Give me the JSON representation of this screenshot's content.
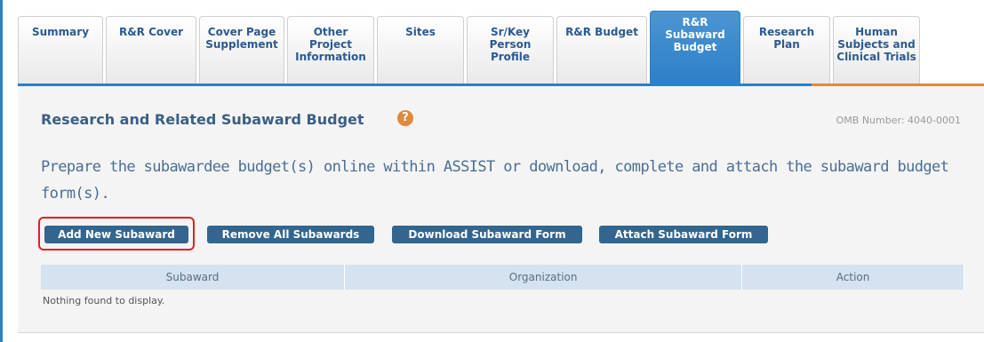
{
  "tabs": [
    {
      "label": "Summary",
      "active": false
    },
    {
      "label": "R&R Cover",
      "active": false
    },
    {
      "label": "Cover Page\nSupplement",
      "active": false
    },
    {
      "label": "Other\nProject\nInformation",
      "active": false
    },
    {
      "label": "Sites",
      "active": false
    },
    {
      "label": "Sr/Key\nPerson\nProfile",
      "active": false
    },
    {
      "label": "R&R Budget",
      "active": false
    },
    {
      "label": "R&R\nSubaward\nBudget",
      "active": true
    },
    {
      "label": "Research\nPlan",
      "active": false
    },
    {
      "label": "Human\nSubjects and\nClinical Trials",
      "active": false
    }
  ],
  "page": {
    "title": "Research and Related Subaward Budget",
    "help_icon": "?",
    "omb": "OMB Number: 4040-0001",
    "instruction": "Prepare the subawardee budget(s) online within ASSIST or download, complete and attach the subaward budget form(s)."
  },
  "buttons": {
    "add": "Add New Subaward",
    "remove_all": "Remove All Subawards",
    "download": "Download Subaward Form",
    "attach": "Attach Subaward Form"
  },
  "table": {
    "columns": [
      "Subaward",
      "Organization",
      "Action"
    ],
    "empty_message": "Nothing found to display."
  },
  "colors": {
    "active_tab": "#2d7fc7",
    "button": "#33658f",
    "highlight": "#e02020",
    "accent_orange": "#e08a3c"
  }
}
